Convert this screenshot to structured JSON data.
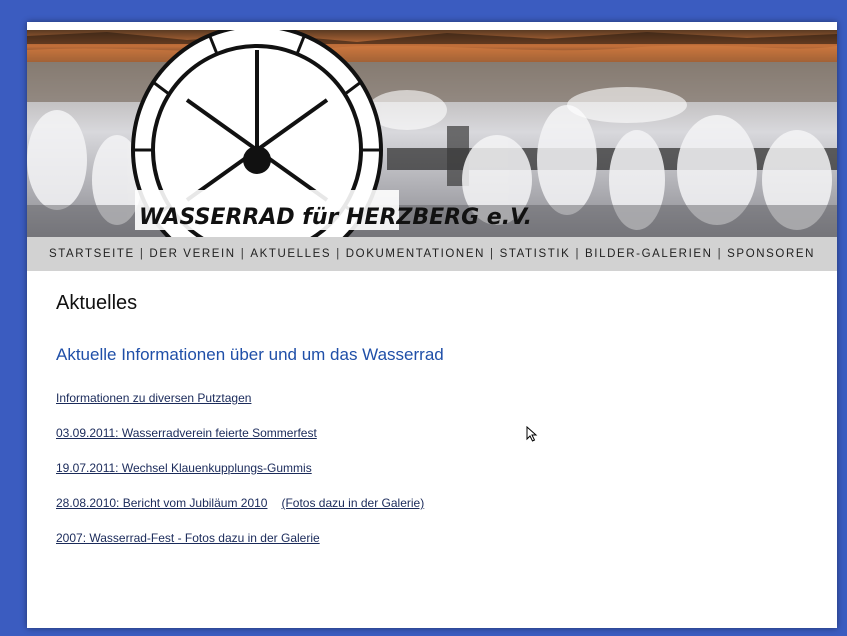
{
  "banner": {
    "logo_text": "WASSERRAD für HERZBERG e.V."
  },
  "nav": {
    "items": [
      {
        "label": "STARTSEITE"
      },
      {
        "label": "DER VEREIN"
      },
      {
        "label": "AKTUELLES"
      },
      {
        "label": "DOKUMENTATIONEN"
      },
      {
        "label": "STATISTIK"
      },
      {
        "label": "BILDER-GALERIEN"
      },
      {
        "label": "SPONSOREN"
      }
    ],
    "separator": "|"
  },
  "main": {
    "title": "Aktuelles",
    "subtitle": "Aktuelle Informationen über und um das Wasserrad",
    "news": [
      {
        "label": "Informationen zu diversen Putztagen"
      },
      {
        "label": "03.09.2011: Wasserradverein feierte Sommerfest"
      },
      {
        "label": "19.07.2011: Wechsel Klauenkupplungs-Gummis"
      },
      {
        "label": "28.08.2010: Bericht vom Jubiläum 2010",
        "extra": "(Fotos dazu in der Galerie)"
      },
      {
        "label": "2007: Wasserrad-Fest - Fotos dazu in der Galerie"
      }
    ]
  },
  "colors": {
    "background": "#3b5cc0",
    "nav_bar": "#d2d2d2",
    "subtitle": "#1f4fa8",
    "link": "#1a2a5a"
  },
  "icons": {
    "cursor": "mouse-pointer-icon",
    "logo": "water-wheel-logo"
  }
}
